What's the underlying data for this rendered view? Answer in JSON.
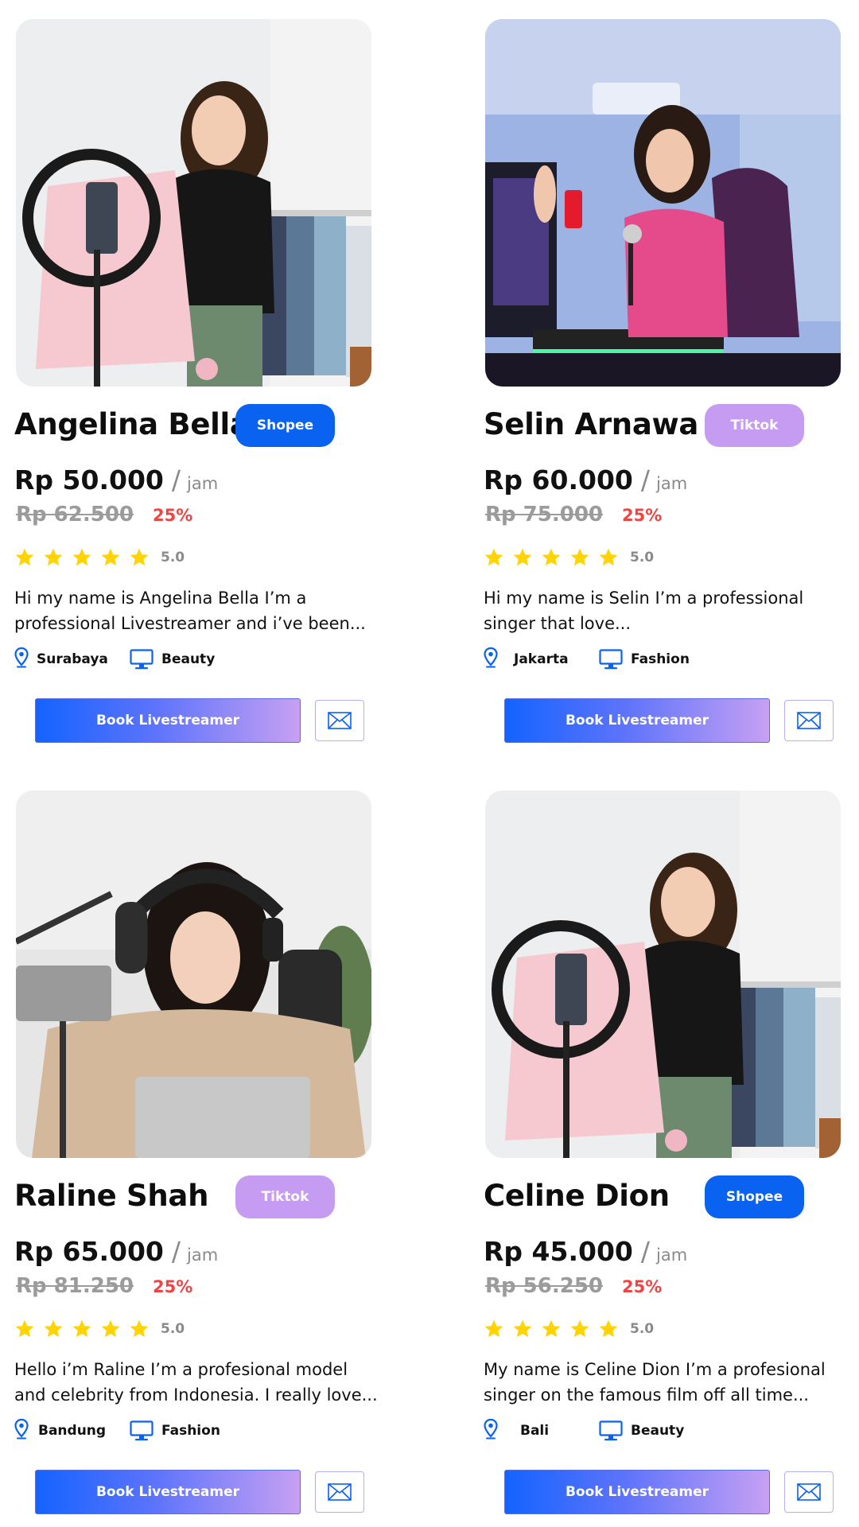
{
  "cards": [
    {
      "name": "Angelina Bella",
      "platform": "Shopee",
      "price": "Rp 50.000",
      "slash": "/",
      "unit": "jam",
      "old_price": "Rp 62.500",
      "discount": "25%",
      "rating": "5.0",
      "stars": 5,
      "description": "Hi  my name is Angelina Bella I’m a professional Livestreamer and i’ve been...",
      "city": "Surabaya",
      "category": "Beauty",
      "book_label": "Book Livestreamer"
    },
    {
      "name": "Selin Arnawa",
      "platform": "Tiktok",
      "price": "Rp 60.000",
      "slash": "/",
      "unit": "jam",
      "old_price": "Rp 75.000",
      "discount": "25%",
      "rating": "5.0",
      "stars": 5,
      "description": "Hi  my name is Selin I’m a professional singer that love...",
      "city": "Jakarta",
      "category": "Fashion",
      "book_label": "Book Livestreamer"
    },
    {
      "name": "Raline Shah",
      "platform": "Tiktok",
      "price": "Rp 65.000",
      "slash": "/",
      "unit": "jam",
      "old_price": "Rp 81.250",
      "discount": "25%",
      "rating": "5.0",
      "stars": 5,
      "description": "Hello i’m Raline I’m a profesional model and celebrity from Indonesia. I really love...",
      "city": "Bandung",
      "category": "Fashion",
      "book_label": "Book Livestreamer"
    },
    {
      "name": "Celine Dion",
      "platform": "Shopee",
      "price": "Rp 45.000",
      "slash": "/",
      "unit": "jam",
      "old_price": "Rp 56.250",
      "discount": "25%",
      "rating": "5.0",
      "stars": 5,
      "description": "My name is Celine Dion I’m a profesional singer on the famous film off all time...",
      "city": "Bali",
      "category": "Beauty",
      "book_label": "Book Livestreamer"
    }
  ],
  "colors": {
    "shopee": "#0a62f0",
    "tiktok": "#c69cf3",
    "star": "#ffd400",
    "discount": "#ef4444",
    "icon_blue": "#0a62f0"
  },
  "icons": {
    "location": "location-pin-icon",
    "category": "monitor-icon",
    "message": "envelope-icon",
    "rating": "star-icon"
  }
}
